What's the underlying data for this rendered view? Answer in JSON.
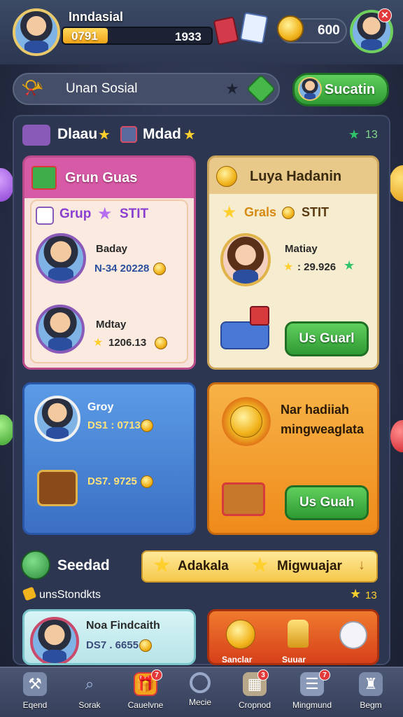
{
  "header": {
    "player_name": "Inndasial",
    "xp_value": "0791",
    "xp_progress": 0.3,
    "score": "1933",
    "coins": "600"
  },
  "search_bar": {
    "label": "Unan Sosial",
    "action_button": "Sucatin"
  },
  "section1": {
    "left_title": "Dlaau",
    "right_title": "Mdad",
    "star_count": "13"
  },
  "card_group": {
    "title": "Grun Guas",
    "subtitle": "Grup",
    "subtitle_tag": "STIT",
    "player1": {
      "name": "Baday",
      "value": "N-34 20228"
    },
    "player2": {
      "name": "Mdtay",
      "value": "1206.13"
    }
  },
  "card_gold": {
    "title": "Luya Hadanin",
    "subtitle": "Grals",
    "subtitle_tag": "STIT",
    "player_name": "Matiay",
    "player_value": ": 29.926",
    "button_label": "Us Guarl"
  },
  "card_blue": {
    "player_name": "Groy",
    "value1": "DS1 : 0713",
    "value2": "DS7. 9725"
  },
  "card_orange": {
    "title_line1": "Nar hadiiah",
    "title_line2": "mingweaglata",
    "button_label": "Us Guah"
  },
  "section2": {
    "title": "Seedad",
    "subtitle": "unsStondkts",
    "banner_left": "Adakala",
    "banner_right": "Migwuajar",
    "star_count": "13"
  },
  "card_teal": {
    "player_name": "Noa Findcaith",
    "value": "DS7 . 6655"
  },
  "card_red": {
    "label_left": "Sanclar",
    "label_right": "Suuar"
  },
  "nav": [
    {
      "label": "Eqend",
      "icon": "hammer-icon",
      "badge": ""
    },
    {
      "label": "Sorak",
      "icon": "search-icon",
      "badge": ""
    },
    {
      "label": "Cauelvne",
      "icon": "gift-icon",
      "badge": "7"
    },
    {
      "label": "Mecie",
      "icon": "magnifier-icon",
      "badge": ""
    },
    {
      "label": "Cropnod",
      "icon": "map-icon",
      "badge": "3"
    },
    {
      "label": "Mingmund",
      "icon": "list-icon",
      "badge": "7"
    },
    {
      "label": "Begm",
      "icon": "trophy-icon",
      "badge": ""
    }
  ],
  "colors": {
    "gold": "#f2b41c",
    "green_button": "#2f9a34",
    "pink_card": "#f4b7d1",
    "gold_card": "#f3e4be",
    "blue_card": "#4a86d6",
    "orange_card": "#f39a22",
    "teal_card": "#c9ecef",
    "red_card": "#e5541e"
  }
}
